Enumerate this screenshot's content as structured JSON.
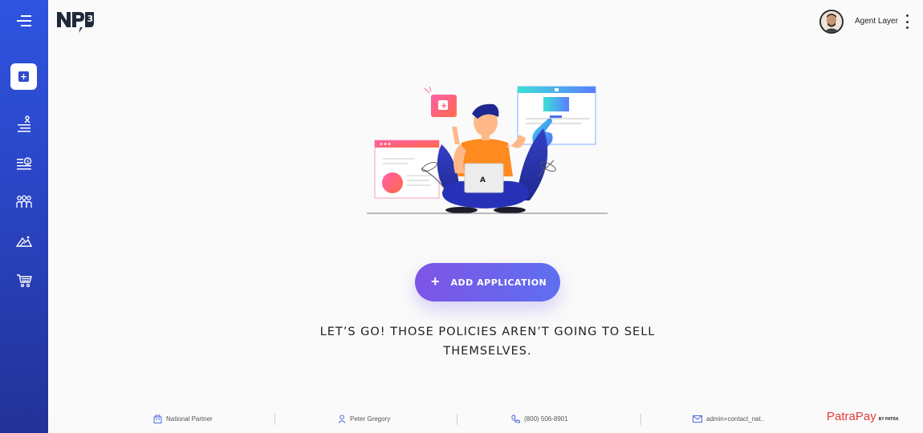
{
  "header": {
    "logo_text": "NP3",
    "user_name": "Agent Layer"
  },
  "sidebar": {
    "items": [
      {
        "icon": "menu-icon"
      },
      {
        "icon": "add-application-icon",
        "active": true
      },
      {
        "icon": "agents-tree-icon"
      },
      {
        "icon": "commissions-list-icon"
      },
      {
        "icon": "team-icon"
      },
      {
        "icon": "analytics-icon"
      },
      {
        "icon": "cart-icon"
      }
    ]
  },
  "main": {
    "add_button_label": "ADD APPLICATION",
    "tagline": "LET’S GO! THOSE POLICIES AREN’T GOING TO SELL THEMSELVES."
  },
  "footer": {
    "company": "National Partner",
    "contact_name": "Peter Gregory",
    "phone": "(800) 506-8901",
    "email": "admin+contact_nat..",
    "brand": "PatraPay",
    "brand_suffix": "BY PATRA"
  },
  "colors": {
    "sidebar_top": "#2f54e0",
    "sidebar_bottom": "#223197",
    "button_gradient_start": "#7e54e6",
    "button_gradient_end": "#5e6ff0",
    "brand_red": "#e63a3a"
  }
}
